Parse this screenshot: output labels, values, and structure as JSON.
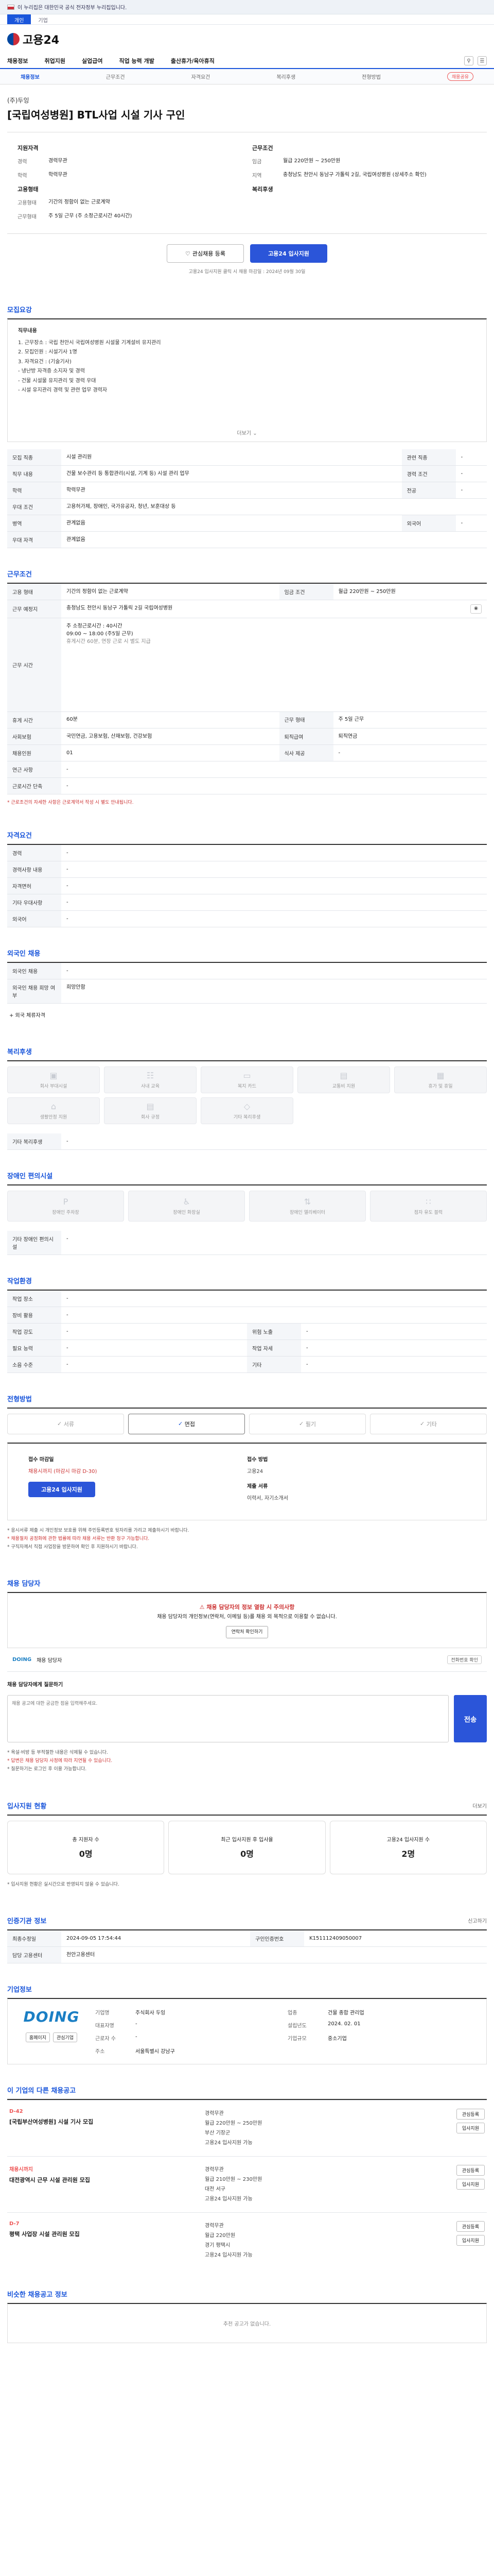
{
  "banner": {
    "text": "이 누리집은 대한민국 공식 전자정부 누리집입니다."
  },
  "tabs": [
    "개인",
    "기업"
  ],
  "logo": {
    "text": "고용24"
  },
  "gnb": [
    "채용정보",
    "취업지원",
    "실업급여",
    "직업 능력 개발",
    "출산휴가/육아휴직"
  ],
  "subnav": {
    "items": [
      "채용정보",
      "근무조건",
      "자격요건",
      "복리후생",
      "전형방법"
    ],
    "share": "채용공유"
  },
  "job": {
    "company": "(주)두잉",
    "title": "[국립여성병원] BTL사업 시설 기사 구인",
    "summary_left_title": "지원자격",
    "summary_right_title": "근무조건",
    "left": [
      {
        "k": "경력",
        "v": "경력무관"
      },
      {
        "k": "학력",
        "v": "학력무관"
      }
    ],
    "left2_title": "고용형태",
    "left2": [
      {
        "k": "고용형태",
        "v": "기간의 정함이 없는 근로계약"
      },
      {
        "k": "근무형태",
        "v": "주 5일 근무 (주 소정근로시간 40시간)"
      }
    ],
    "right": [
      {
        "k": "임금",
        "v": "월급 220만원 ~ 250만원"
      },
      {
        "k": "지역",
        "v": "충청남도 천안시 동남구 가톨릭 2길, 국립여성병원 (상세주소 확인)"
      }
    ],
    "right2_title": "복리후생"
  },
  "actions": {
    "scrap": "관심채용 등록",
    "apply": "고용24 입사지원"
  },
  "apply_note": "고용24 입사지원 클릭 시 채용 마감일 : 2024년 09월 30일",
  "duty": {
    "title": "모집요강",
    "head": "직무내용",
    "lines": [
      "1. 근무장소 : 국립 천안시 국립여성병원 시설물 기계설비 유지관리",
      "2. 모집인원 : 시설기사 1명",
      "3. 자격요건 : (기술기사)",
      "   - 냉난방 자격증 소지자 및 경력",
      "   - 건물 시설물 유지관리 및 경력 우대",
      "   - 시설 유지관리 경력 및 관련 업무 경력자"
    ],
    "more": "더보기"
  },
  "recruit": {
    "rows": [
      [
        "모집 직종",
        "시설 관리원",
        "관련 직종",
        "-"
      ],
      [
        "직무 내용",
        "건물 보수관리 등 통합관리(시설, 기계 등) 시설 관리 업무",
        "경력 조건",
        "-"
      ],
      [
        "학력",
        "학력무관",
        "전공",
        "-"
      ],
      [
        "우대 조건",
        "고용허가제, 장애인, 국가유공자, 청년, 보훈대상 등",
        "",
        ""
      ],
      [
        "병역",
        "관계없음",
        "외국어",
        "-"
      ],
      [
        "우대 자격",
        "관계없음",
        "",
        ""
      ]
    ]
  },
  "conditions": {
    "title": "근무조건",
    "rows": [
      [
        "고용 형태",
        "기간의 정함이 없는 근로계약",
        "임금 조건",
        "월급 220만원 ~ 250만원"
      ],
      [
        "근무 예정지",
        "충청남도 천안시 동남구 가톨릭 2길 국립여성병원",
        "",
        ""
      ],
      [
        "근무 시간",
        "주 소정근로시간 : 40시간",
        "",
        ""
      ],
      [
        "",
        "09:00 ~ 18:00 (주5일 근무)",
        "",
        ""
      ],
      [
        "",
        "휴게시간 60분, 연장 근로 시 별도 지급",
        "",
        ""
      ]
    ],
    "bottom": [
      [
        "휴게 시간",
        "60분",
        "근무 형태",
        "주 5일 근무"
      ],
      [
        "사회보험",
        "국민연금, 고용보험, 산재보험, 건강보험",
        "퇴직급여",
        "퇴직연금"
      ],
      [
        "채용인원",
        "01",
        "식사 제공",
        "-"
      ],
      [
        "연근 사항",
        "-",
        "",
        ""
      ],
      [
        "근로시간 단축",
        "-",
        "",
        ""
      ]
    ],
    "notice": "* 근로조건의 자세한 사항은 근로계약서 작성 시 별도 안내됩니다."
  },
  "qualify": {
    "title": "자격요건",
    "rows": [
      [
        "경력",
        "-"
      ],
      [
        "경력사항 내용",
        "-"
      ],
      [
        "자격면허",
        "-"
      ],
      [
        "기타 우대사항",
        "-"
      ],
      [
        "외국어",
        "-"
      ]
    ]
  },
  "foreign": {
    "title": "외국인 채용",
    "rows": [
      [
        "외국인 채용",
        "-"
      ],
      [
        "외국인 채용 희망 여부",
        "희망안함"
      ]
    ],
    "link": "+ 외국 체류자격"
  },
  "welfare": {
    "title": "복리후생",
    "items": [
      "회사 부대시설",
      "사내 교육",
      "복지 카드",
      "교통비 지원",
      "휴가 및 휴일",
      "생활안정 지원",
      "회사 규정",
      "기타 복리후생"
    ],
    "other_label": "기타 복리후생",
    "other_value": "-"
  },
  "disabled": {
    "title": "장애인 편의시설",
    "items": [
      "장애인 주차장",
      "장애인 화장실",
      "장애인 엘리베이터",
      "점자 유도 블럭"
    ],
    "other_label": "기타 장애인 편의시설",
    "other_value": "-"
  },
  "work_env": {
    "title": "작업환경",
    "rows": [
      [
        "작업 장소",
        "-",
        "",
        ""
      ],
      [
        "장비 활용",
        "-",
        "",
        ""
      ],
      [
        "작업 강도",
        "-",
        "위험 노출",
        "-"
      ],
      [
        "필요 능력",
        "-",
        "작업 자세",
        "-"
      ],
      [
        "소음 수준",
        "-",
        "기타",
        "-"
      ]
    ]
  },
  "selection": {
    "title": "전형방법",
    "methods": [
      "서류",
      "면접",
      "필기",
      "기타"
    ],
    "on": "면접",
    "deadline_label": "접수 마감일",
    "deadline_value": "채용시까지 (마감시 마감 D-30)",
    "method_label": "접수 방법",
    "method_value": "고용24",
    "apply_btn": "고용24 입사지원",
    "docs_label": "제출 서류",
    "docs_value": "이력서, 자기소개서",
    "warns": [
      "* 응시서류 제출 시 개인정보 보호를 위해 주민등록번호 뒷자리를 가리고 제출하시기 바랍니다.",
      "* 채용절차 공정화에 관한 법률에 따라 채용 서류는 반환 청구 가능합니다.",
      "* 구직자께서 직접 사업장을 방문하여 확인 후 지원하시기 바랍니다."
    ]
  },
  "qna": {
    "title": "채용 담당자",
    "warn_head": "채용 담당자의 정보 열람 시 주의사항",
    "warn_body": "채용 담당자의 개인정보(연락처, 이메일 등)를 채용 외 목적으로 이용할 수 없습니다.",
    "view_btn": "연락처 확인하기",
    "contact_badge": "DOING",
    "contact_name": "채용 담당자",
    "contact_phone": "전화번호 확인",
    "q_title": "채용 담당자에게 질문하기",
    "q_placeholder": "채용 공고에 대한 궁금한 점을 입력해주세요.",
    "q_btn": "전송",
    "q_notes": [
      "* 욕설·비방 등 부적절한 내용은 삭제될 수 있습니다.",
      "* 답변은 채용 담당자 사정에 따라 지연될 수 있습니다.",
      "* 질문하기는 로그인 후 이용 가능합니다."
    ]
  },
  "stats": {
    "title": "입사지원 현황",
    "right": "더보기",
    "items": [
      {
        "label": "총 지원자 수",
        "value": "0명"
      },
      {
        "label": "최근 입사지원 후 입사율",
        "value": "0명"
      },
      {
        "label": "고용24 입사지원 수",
        "value": "2명"
      }
    ],
    "note": "* 입사지원 현황은 실시간으로 반영되지 않을 수 있습니다."
  },
  "info": {
    "title": "인증기관 정보",
    "rows": [
      [
        "최종수정일",
        "2024-09-05 17:54:44",
        "구인인증번호",
        "K151112409050007"
      ],
      [
        "담당 고용센터",
        "천안고용센터",
        "",
        ""
      ]
    ],
    "report": "신고하기"
  },
  "company": {
    "title": "기업정보",
    "brand": "DOING",
    "mini": [
      "홈페이지",
      "관심기업"
    ],
    "rows": [
      [
        "기업명",
        "주식회사 두잉",
        "업종",
        "건물 종합 관리업"
      ],
      [
        "대표자명",
        "-",
        "설립년도",
        "2024. 02. 01"
      ],
      [
        "근로자 수",
        "-",
        "기업규모",
        "중소기업"
      ],
      [
        "주소",
        "서울특별시 강남구",
        "",
        ""
      ]
    ]
  },
  "other_jobs": {
    "title": "이 기업의 다른 채용공고",
    "items": [
      {
        "dday": "D-42",
        "name": "[국립부산여성병원] 시설 기사 모집",
        "meta": [
          "경력무관",
          "월급 220만원 ~ 250만원",
          "부산 기장군",
          "고용24 입사지원 가능"
        ]
      },
      {
        "dday": "채용시까지",
        "name": "대전광역시 근무 시설 관리원 모집",
        "meta": [
          "경력무관",
          "월급 210만원 ~ 230만원",
          "대전 서구",
          "고용24 입사지원 가능"
        ]
      },
      {
        "dday": "D-7",
        "name": "평택 사업장 시설 관리원 모집",
        "meta": [
          "경력무관",
          "월급 220만원",
          "경기 평택시",
          "고용24 입사지원 가능"
        ]
      }
    ],
    "btn_scrap": "관심등록",
    "btn_apply": "입사지원"
  },
  "similar": {
    "title": "비슷한 채용공고 정보",
    "empty": "추천 공고가 없습니다."
  }
}
